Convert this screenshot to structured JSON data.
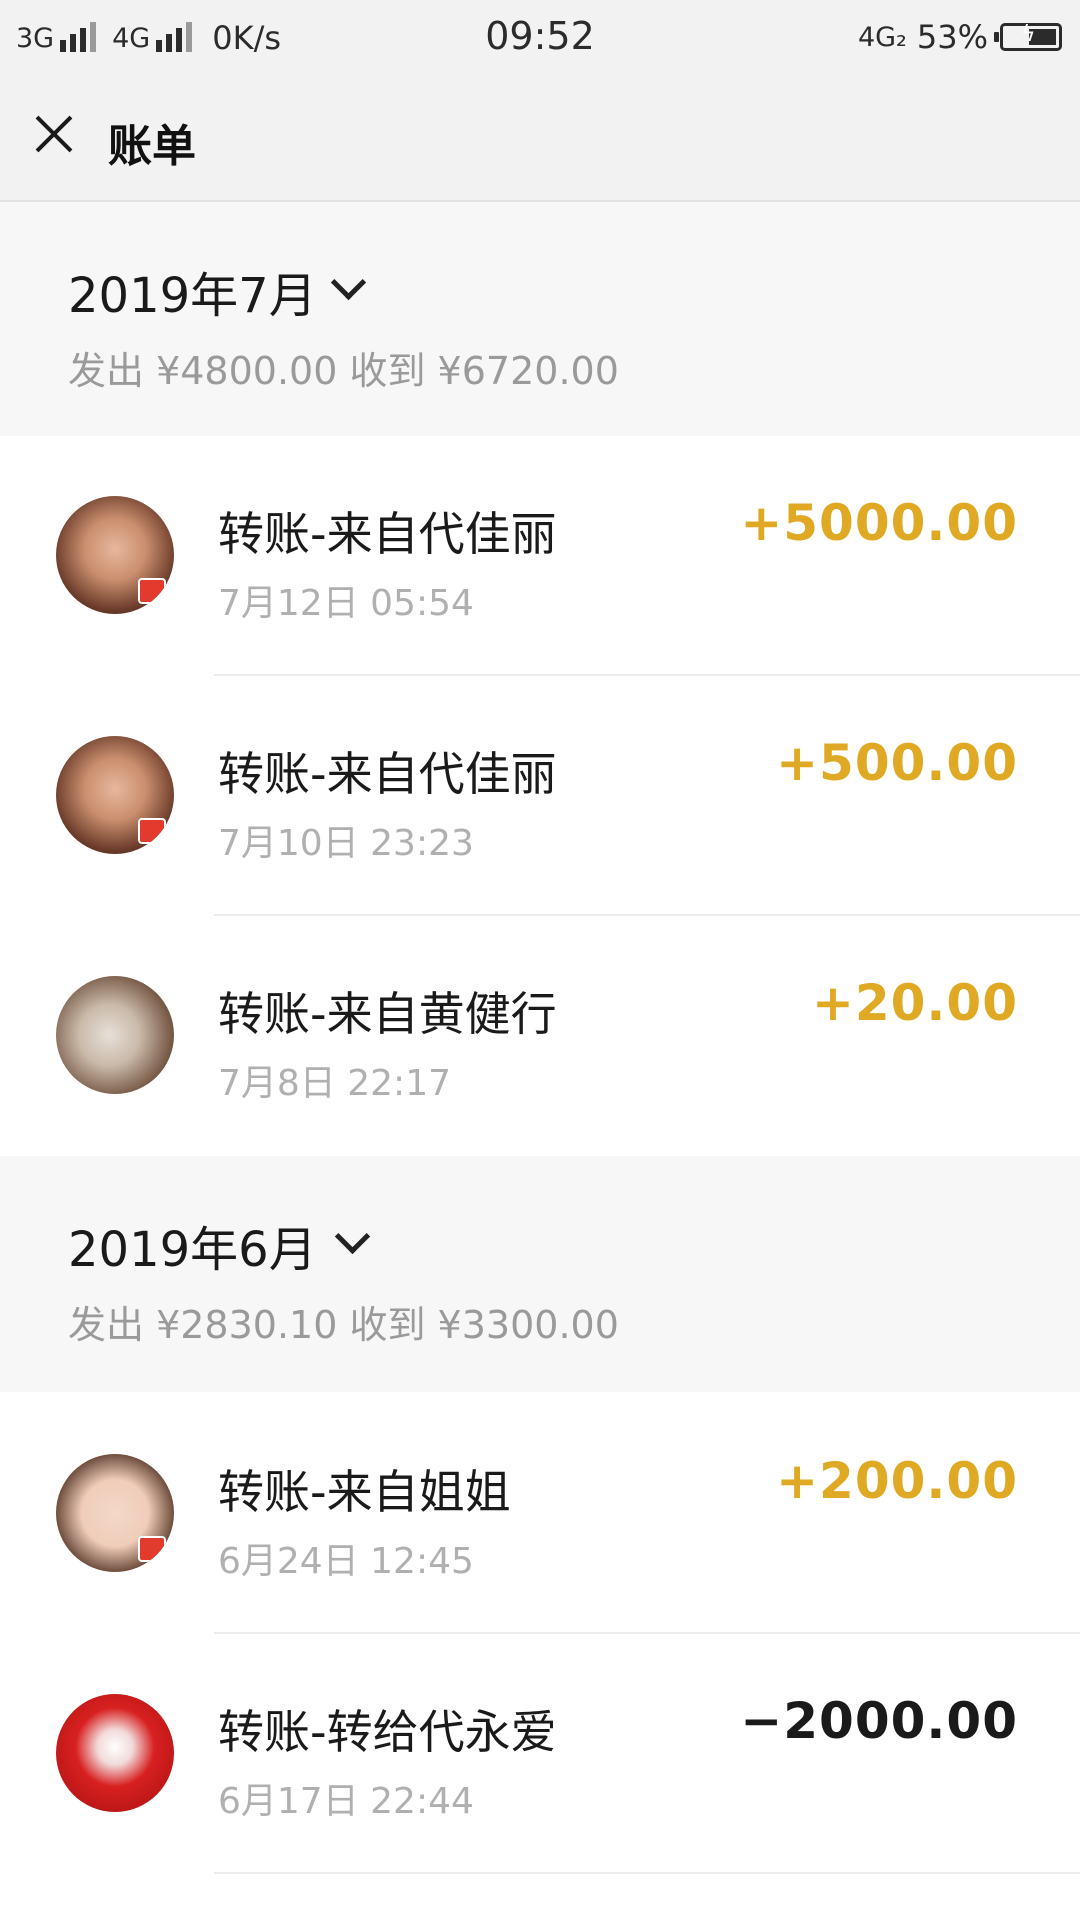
{
  "status_bar": {
    "net1": "3G",
    "net2": "4G",
    "speed": "0K/s",
    "time": "09:52",
    "net3": "4G₂",
    "battery": "53%",
    "battery_level": 0.53
  },
  "header": {
    "close_icon": "close-icon",
    "title": "账单"
  },
  "months": [
    {
      "label": "2019年7月",
      "summary": "发出 ¥4800.00 收到 ¥6720.00",
      "items": [
        {
          "title": "转账-来自代佳丽",
          "time": "7月12日 05:54",
          "amount": "+5000.00",
          "direction": "in"
        },
        {
          "title": "转账-来自代佳丽",
          "time": "7月10日 23:23",
          "amount": "+500.00",
          "direction": "in"
        },
        {
          "title": "转账-来自黄健行",
          "time": "7月8日 22:17",
          "amount": "+20.00",
          "direction": "in"
        }
      ]
    },
    {
      "label": "2019年6月",
      "summary": "发出 ¥2830.10 收到 ¥3300.00",
      "items": [
        {
          "title": "转账-来自姐姐",
          "time": "6月24日 12:45",
          "amount": "+200.00",
          "direction": "in"
        },
        {
          "title": "转账-转给代永爱",
          "time": "6月17日 22:44",
          "amount": "−2000.00",
          "direction": "out"
        }
      ]
    }
  ],
  "colors": {
    "income": "#e0a924",
    "expense": "#1a1a1a",
    "secondary_text": "#9a9a9a"
  }
}
